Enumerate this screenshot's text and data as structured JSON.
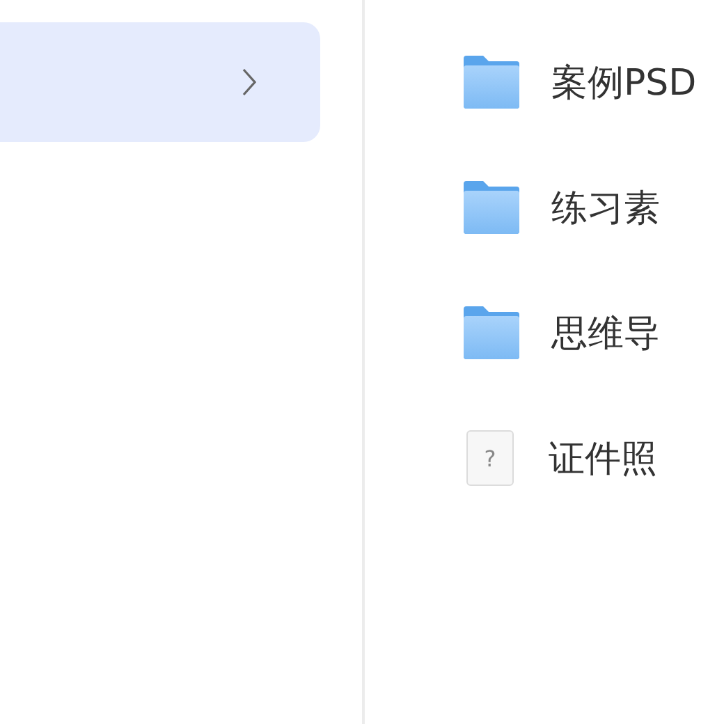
{
  "sidebar": {
    "items": [
      {
        "selected": true
      }
    ]
  },
  "files": [
    {
      "kind": "folder",
      "name": "案例PSD"
    },
    {
      "kind": "folder",
      "name": "练习素"
    },
    {
      "kind": "folder",
      "name": "思维导"
    },
    {
      "kind": "unknown",
      "name": "证件照",
      "icon_text": "?"
    }
  ]
}
